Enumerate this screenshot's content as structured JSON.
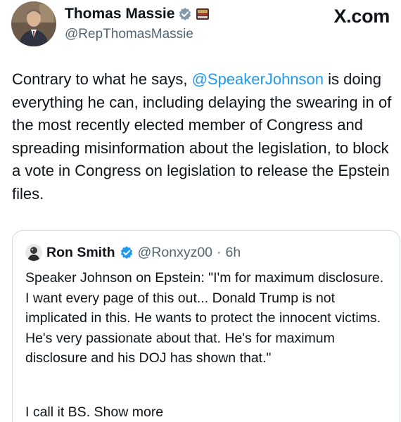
{
  "author": {
    "display_name": "Thomas Massie",
    "handle": "@RepThomasMassie",
    "avatar_icon": "avatar-man-suit-icon",
    "badges": [
      "government-verified-badge-icon",
      "flag-emoji-icon"
    ]
  },
  "brand": "X.com",
  "tweet": {
    "pre_mention": "Contrary to what he says, ",
    "mention": "@SpeakerJohnson",
    "post_mention": " is doing everything he can, including delaying the swearing in of the most recently elected member of Congress and spreading misinformation about the legislation, to block a vote in Congress on legislation to release the Epstein files."
  },
  "quote": {
    "display_name": "Ron Smith",
    "handle": "@Ronxyz00",
    "separator": "·",
    "time": "6h",
    "verified_icon": "verified-check-icon",
    "text": "Speaker Johnson on Epstein: \"I'm for maximum disclosure. I want every page of this out... Donald Trump is not implicated in this. He wants to protect the innocent victims. He's very passionate about that. He's for maximum disclosure and his DOJ has shown that.\"",
    "extra_text": "I call it BS. Show more"
  },
  "colors": {
    "text": "#0f1419",
    "secondary": "#536471",
    "accent": "#1d9bf0",
    "border": "#cfd9de"
  }
}
